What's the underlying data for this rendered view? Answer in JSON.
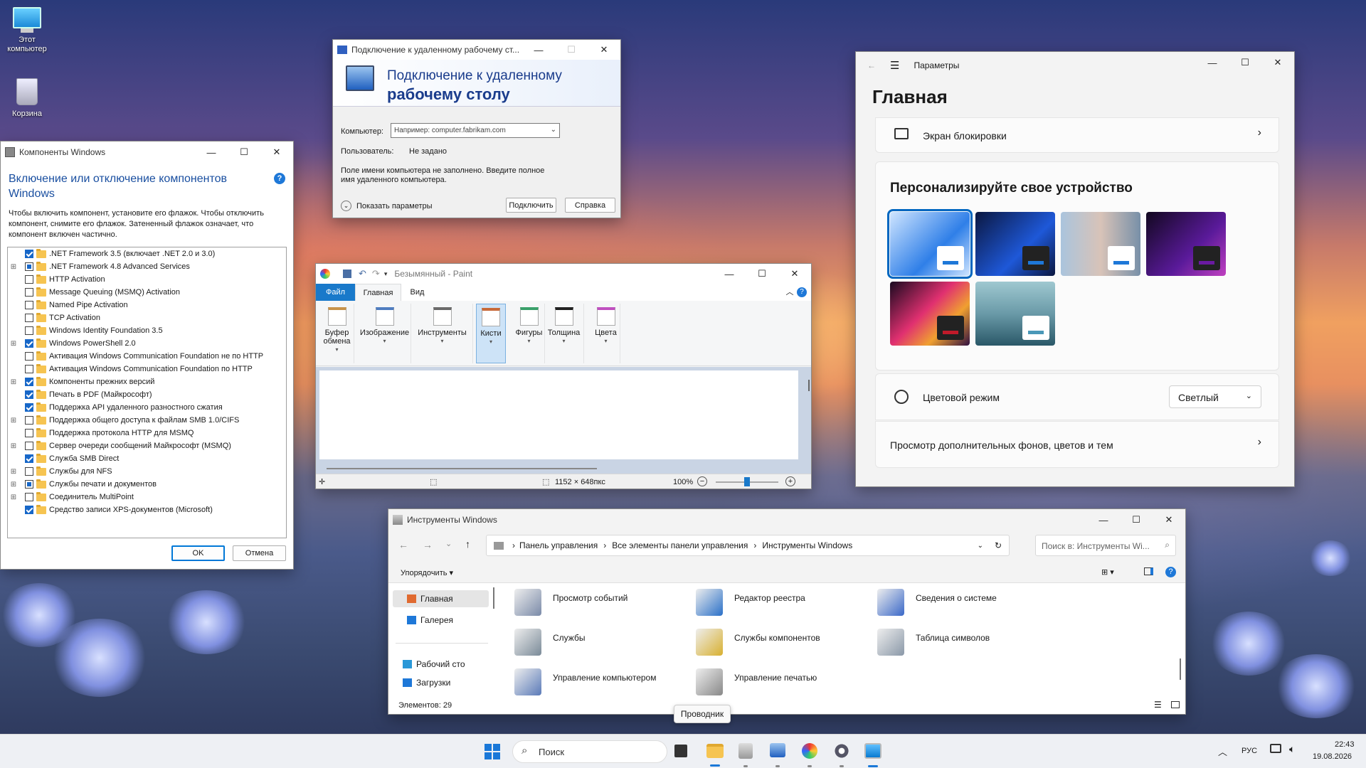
{
  "desktop": {
    "this_pc": "Этот\nкомпьютер",
    "recycle": "Корзина"
  },
  "features": {
    "title": "Компоненты Windows",
    "heading": "Включение или отключение компонентов Windows",
    "desc": "Чтобы включить компонент, установите его флажок. Чтобы отключить компонент, снимите его флажок. Затененный флажок означает, что компонент включен частично.",
    "items": [
      {
        "label": ".NET Framework 3.5 (включает .NET 2.0 и 3.0)",
        "state": "on",
        "expand": false
      },
      {
        "label": ".NET Framework 4.8 Advanced Services",
        "state": "part",
        "expand": true
      },
      {
        "label": "HTTP Activation",
        "state": "off",
        "expand": false
      },
      {
        "label": "Message Queuing (MSMQ) Activation",
        "state": "off",
        "expand": false
      },
      {
        "label": "Named Pipe Activation",
        "state": "off",
        "expand": false
      },
      {
        "label": "TCP Activation",
        "state": "off",
        "expand": false
      },
      {
        "label": "Windows Identity Foundation 3.5",
        "state": "off",
        "expand": false
      },
      {
        "label": "Windows PowerShell 2.0",
        "state": "on",
        "expand": true
      },
      {
        "label": "Активация Windows Communication Foundation не по HTTP",
        "state": "off",
        "expand": false
      },
      {
        "label": "Активация Windows Communication Foundation по HTTP",
        "state": "off",
        "expand": false
      },
      {
        "label": "Компоненты прежних версий",
        "state": "on",
        "expand": true
      },
      {
        "label": "Печать в PDF (Майкрософт)",
        "state": "on",
        "expand": false
      },
      {
        "label": "Поддержка API удаленного разностного сжатия",
        "state": "on",
        "expand": false
      },
      {
        "label": "Поддержка общего доступа к файлам SMB 1.0/CIFS",
        "state": "off",
        "expand": true
      },
      {
        "label": "Поддержка протокола HTTP для MSMQ",
        "state": "off",
        "expand": false
      },
      {
        "label": "Сервер очереди сообщений Майкрософт (MSMQ)",
        "state": "off",
        "expand": true
      },
      {
        "label": "Служба SMB Direct",
        "state": "on",
        "expand": false
      },
      {
        "label": "Службы для NFS",
        "state": "off",
        "expand": true
      },
      {
        "label": "Службы печати и документов",
        "state": "part",
        "expand": true
      },
      {
        "label": "Соединитель MultiPoint",
        "state": "off",
        "expand": true
      },
      {
        "label": "Средство записи XPS-документов (Microsoft)",
        "state": "on",
        "expand": false
      }
    ],
    "ok": "OK",
    "cancel": "Отмена"
  },
  "rdp": {
    "title": "Подключение к удаленному рабочему ст...",
    "banner1": "Подключение к удаленному",
    "banner2": "рабочему столу",
    "computer_label": "Компьютер:",
    "computer_placeholder": "Например: computer.fabrikam.com",
    "user_label": "Пользователь:",
    "user_value": "Не задано",
    "warning": "Поле имени компьютера не заполнено. Введите полное имя удаленного компьютера.",
    "show_options": "Показать параметры",
    "connect": "Подключить",
    "help": "Справка"
  },
  "paint": {
    "title": "Безымянный - Paint",
    "tabs": [
      "Файл",
      "Главная",
      "Вид"
    ],
    "groups": [
      "Буфер обмена",
      "Изображение",
      "Инструменты",
      "Кисти",
      "Фигуры",
      "Толщина",
      "Цвета"
    ],
    "size": "1152 × 648пкс",
    "zoom": "100%",
    "zoom_level": 0.5
  },
  "settings": {
    "app": "Параметры",
    "heading": "Главная",
    "lock": "Экран блокировки",
    "personalize": "Персонализируйте свое устройство",
    "color_mode": "Цветовой режим",
    "color_value": "Светлый",
    "more": "Просмотр дополнительных фонов, цветов и тем"
  },
  "explorer": {
    "title": "Инструменты Windows",
    "crumbs": [
      "Панель управления",
      "Все элементы панели управления",
      "Инструменты Windows"
    ],
    "search": "Поиск в: Инструменты Wi...",
    "sort": "Упорядочить",
    "nav": [
      "Главная",
      "Галерея",
      "Рабочий сто",
      "Загрузки"
    ],
    "items": [
      "Просмотр событий",
      "Редактор реестра",
      "Сведения о системе",
      "Службы",
      "Службы компонентов",
      "Таблица символов",
      "Управление компьютером",
      "Управление печатью"
    ],
    "status": "Элементов: 29",
    "tooltip": "Проводник"
  },
  "taskbar": {
    "search": "Поиск",
    "lang": "РУС",
    "time": "22:43",
    "date": "19.08.2026"
  },
  "colors": {
    "accent": "#0067c0",
    "rdp_blue": "#003399"
  }
}
